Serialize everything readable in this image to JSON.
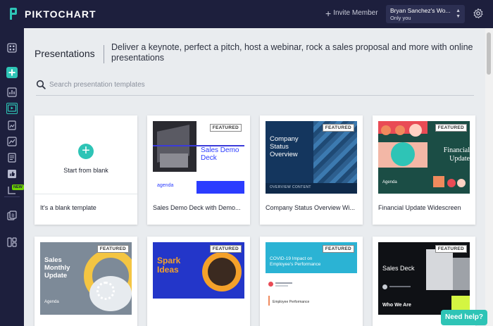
{
  "app": {
    "logo_text": "PIKTOCHART"
  },
  "topbar": {
    "invite_label": "Invite Member",
    "account_name": "Bryan Sanchez's Wo...",
    "account_sub": "Only you"
  },
  "sidebar": {
    "new_badge": "NEW",
    "items": [
      "dashboard-icon",
      "create-icon",
      "chart-icon",
      "presentation-icon",
      "poster-icon",
      "infographic-icon",
      "document-icon",
      "social-icon",
      "report-icon",
      "brand-assets-icon",
      "templates-icon"
    ]
  },
  "page": {
    "title": "Presentations",
    "subtitle": "Deliver a keynote, perfect a pitch, host a webinar, rock a sales proposal and more with online presentations"
  },
  "search": {
    "placeholder": "Search presentation templates"
  },
  "blank": {
    "cta": "Start from blank",
    "label": "It's a blank template"
  },
  "badge": "FEATURED",
  "templates": [
    {
      "label": "Sales Demo Deck with Demo...",
      "thumb_title": "Sales Demo Deck",
      "thumb_foot": "agenda"
    },
    {
      "label": "Company Status Overview Wi...",
      "thumb_title": "Company Status Overview",
      "thumb_foot": "OVERVIEW CONTENT"
    },
    {
      "label": "Financial Update Widescreen",
      "thumb_title": "Financial Update",
      "thumb_foot": "Agenda"
    },
    {
      "label": "",
      "thumb_title": "Sales Monthly Update",
      "thumb_foot": "Agenda"
    },
    {
      "label": "",
      "thumb_title": "Spark Ideas",
      "thumb_foot": ""
    },
    {
      "label": "",
      "thumb_title": "COVID-19 Impact on Employee's Performance",
      "thumb_foot": "Employee Performance"
    },
    {
      "label": "",
      "thumb_title": "Sales Deck",
      "thumb_foot": "Who We Are"
    }
  ],
  "help": {
    "label": "Need help?"
  },
  "colors": {
    "nav": "#1d1f3d",
    "accent": "#2ec4b6",
    "background": "#e9ecef"
  }
}
